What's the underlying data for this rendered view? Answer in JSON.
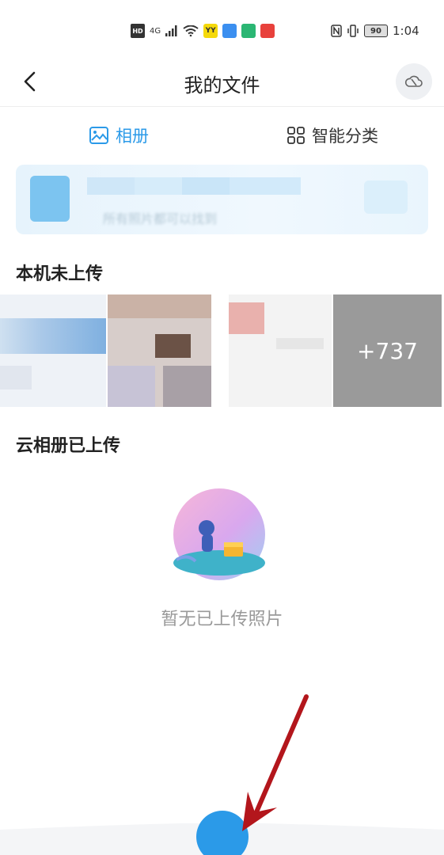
{
  "status_bar": {
    "hd": "HD",
    "network": "4G",
    "app_badges": [
      {
        "label": "YY",
        "color": "#f5d90a",
        "text_color": "#333333"
      },
      {
        "label": "",
        "color": "#3b8ff0",
        "text_color": "#ffffff"
      },
      {
        "label": "",
        "color": "#2bb673",
        "text_color": "#ffffff"
      },
      {
        "label": "",
        "color": "#e8413c",
        "text_color": "#ffffff"
      }
    ],
    "battery": "90",
    "time": "1:04"
  },
  "header": {
    "title": "我的文件"
  },
  "tabs": [
    {
      "label": "相册",
      "active": true
    },
    {
      "label": "智能分类",
      "active": false
    }
  ],
  "banner": {
    "subtitle": "所有照片都可以找到"
  },
  "sections": {
    "local_title": "本机未上传",
    "cloud_title": "云相册已上传"
  },
  "local_photos": {
    "more_count": "+737"
  },
  "empty_state": {
    "text": "暂无已上传照片"
  },
  "colors": {
    "accent": "#2b9ae8",
    "annotation_arrow": "#b3161c"
  }
}
